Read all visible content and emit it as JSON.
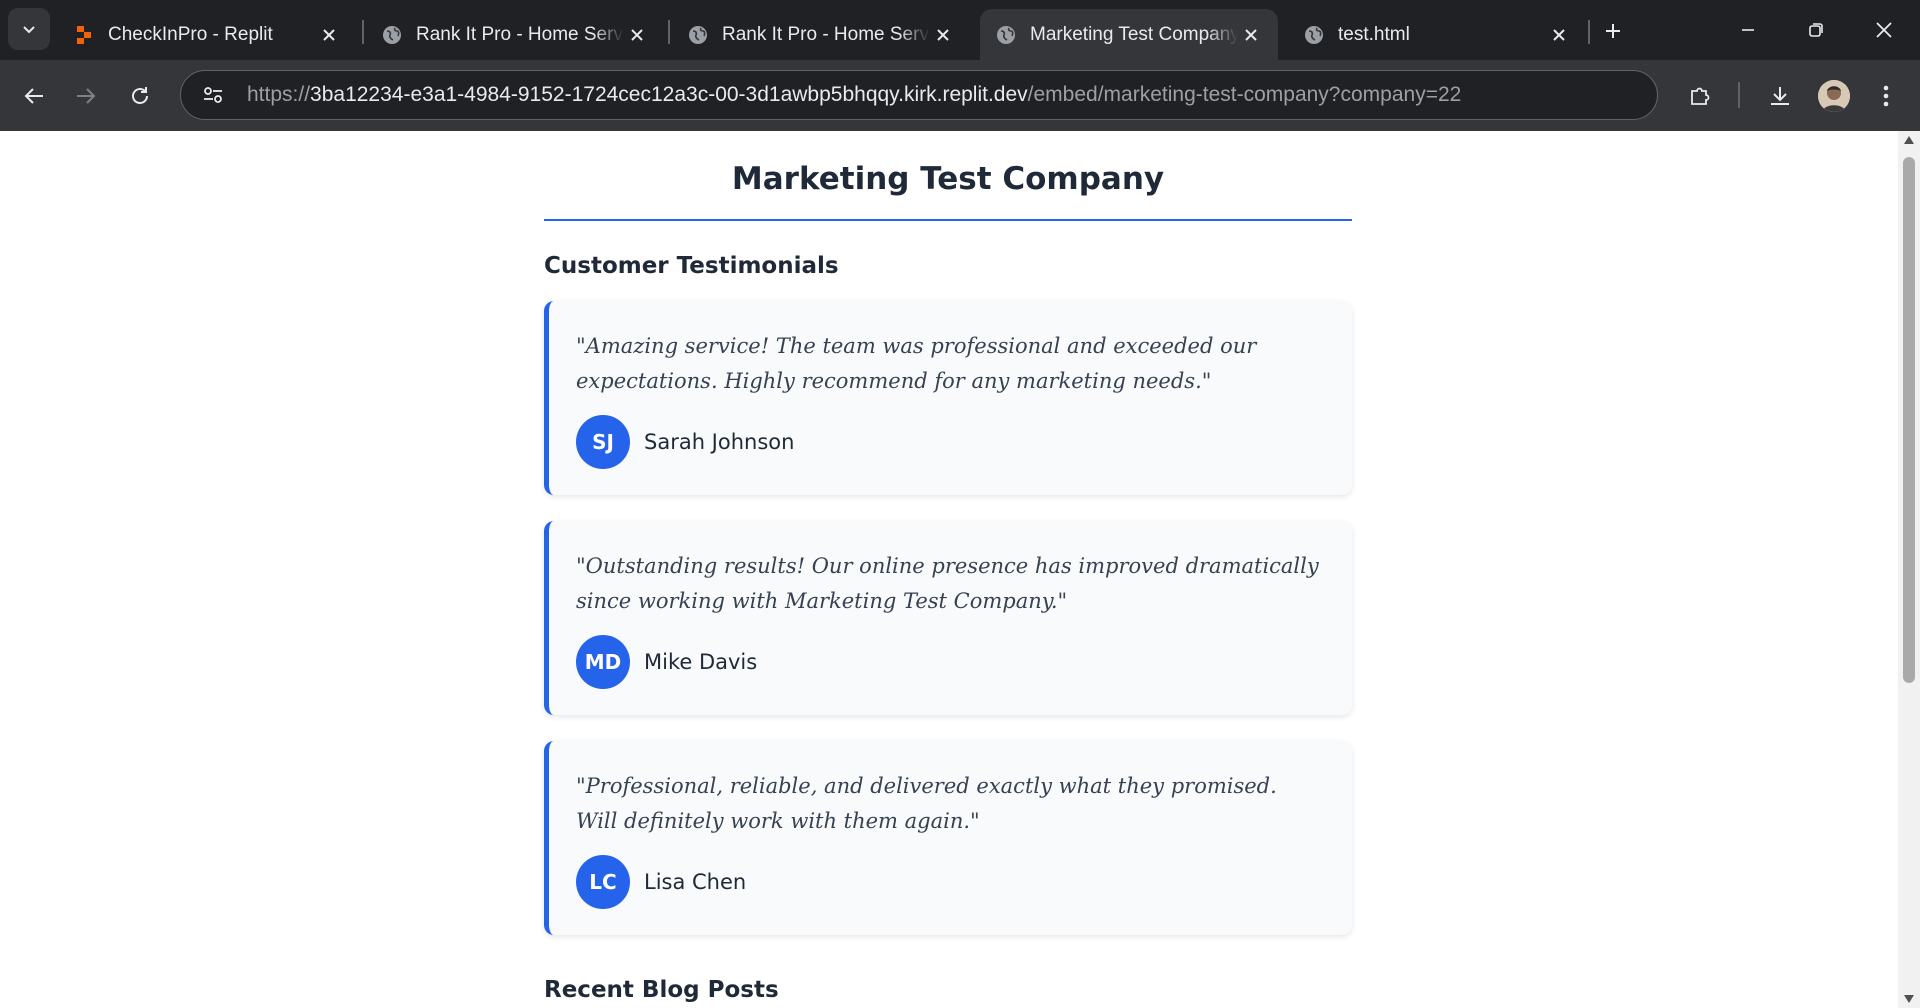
{
  "browser": {
    "tabs": [
      {
        "title": "CheckInPro - Replit",
        "favicon": "replit-icon",
        "active": false
      },
      {
        "title": "Rank It Pro - Home Servi",
        "favicon": "globe-icon",
        "active": false
      },
      {
        "title": "Rank It Pro - Home Servi",
        "favicon": "globe-icon",
        "active": false
      },
      {
        "title": "Marketing Test Company",
        "favicon": "globe-icon",
        "active": true
      },
      {
        "title": "test.html",
        "favicon": "globe-icon",
        "active": false
      }
    ],
    "url": {
      "scheme": "https://",
      "host": "3ba12234-e3a1-4984-9152-1724cec12a3c-00-3d1awbp5bhqqy.kirk.replit.dev",
      "path": "/embed/marketing-test-company?company=22"
    }
  },
  "page": {
    "company_name": "Marketing Test Company",
    "testimonials_heading": "Customer Testimonials",
    "testimonials": [
      {
        "quote": "\"Amazing service! The team was professional and exceeded our expectations. Highly recommend for any marketing needs.\"",
        "initials": "SJ",
        "name": "Sarah Johnson"
      },
      {
        "quote": "\"Outstanding results! Our online presence has improved dramatically since working with Marketing Test Company.\"",
        "initials": "MD",
        "name": "Mike Davis"
      },
      {
        "quote": "\"Professional, reliable, and delivered exactly what they promised. Will definitely work with them again.\"",
        "initials": "LC",
        "name": "Lisa Chen"
      }
    ],
    "blog_heading": "Recent Blog Posts"
  },
  "colors": {
    "accent": "#2563eb",
    "card_bg": "#f8fafc",
    "chrome_dark": "#202124",
    "chrome_toolbar": "#35363a"
  }
}
